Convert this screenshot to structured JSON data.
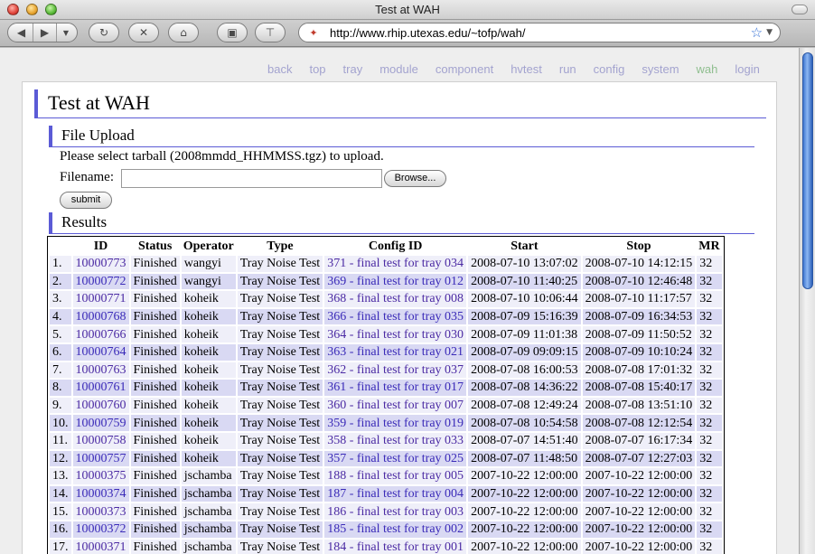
{
  "window": {
    "title": "Test at WAH"
  },
  "browser": {
    "url": "http://www.rhip.utexas.edu/~tofp/wah/"
  },
  "nav": {
    "items": [
      "back",
      "top",
      "tray",
      "module",
      "component",
      "hvtest",
      "run",
      "config",
      "system",
      "wah",
      "login"
    ],
    "current": "wah"
  },
  "page": {
    "title": "Test at WAH",
    "upload": {
      "heading": "File Upload",
      "instructions": "Please select tarball (2008mmdd_HHMMSS.tgz) to upload.",
      "filename_label": "Filename:",
      "browse_label": "Browse...",
      "submit_label": "submit"
    },
    "results": {
      "heading": "Results",
      "columns": [
        "",
        "ID",
        "Status",
        "Operator",
        "Type",
        "Config ID",
        "Start",
        "Stop",
        "MR"
      ],
      "rows": [
        [
          "1.",
          "10000773",
          "Finished",
          "wangyi",
          "Tray Noise Test",
          "371 - final test for tray 034",
          "2008-07-10 13:07:02",
          "2008-07-10 14:12:15",
          "32"
        ],
        [
          "2.",
          "10000772",
          "Finished",
          "wangyi",
          "Tray Noise Test",
          "369 - final test for tray 012",
          "2008-07-10 11:40:25",
          "2008-07-10 12:46:48",
          "32"
        ],
        [
          "3.",
          "10000771",
          "Finished",
          "koheik",
          "Tray Noise Test",
          "368 - final test for tray 008",
          "2008-07-10 10:06:44",
          "2008-07-10 11:17:57",
          "32"
        ],
        [
          "4.",
          "10000768",
          "Finished",
          "koheik",
          "Tray Noise Test",
          "366 - final test for tray 035",
          "2008-07-09 15:16:39",
          "2008-07-09 16:34:53",
          "32"
        ],
        [
          "5.",
          "10000766",
          "Finished",
          "koheik",
          "Tray Noise Test",
          "364 - final test for tray 030",
          "2008-07-09 11:01:38",
          "2008-07-09 11:50:52",
          "32"
        ],
        [
          "6.",
          "10000764",
          "Finished",
          "koheik",
          "Tray Noise Test",
          "363 - final test for tray 021",
          "2008-07-09 09:09:15",
          "2008-07-09 10:10:24",
          "32"
        ],
        [
          "7.",
          "10000763",
          "Finished",
          "koheik",
          "Tray Noise Test",
          "362 - final test for tray 037",
          "2008-07-08 16:00:53",
          "2008-07-08 17:01:32",
          "32"
        ],
        [
          "8.",
          "10000761",
          "Finished",
          "koheik",
          "Tray Noise Test",
          "361 - final test for tray 017",
          "2008-07-08 14:36:22",
          "2008-07-08 15:40:17",
          "32"
        ],
        [
          "9.",
          "10000760",
          "Finished",
          "koheik",
          "Tray Noise Test",
          "360 - final test for tray 007",
          "2008-07-08 12:49:24",
          "2008-07-08 13:51:10",
          "32"
        ],
        [
          "10.",
          "10000759",
          "Finished",
          "koheik",
          "Tray Noise Test",
          "359 - final test for tray 019",
          "2008-07-08 10:54:58",
          "2008-07-08 12:12:54",
          "32"
        ],
        [
          "11.",
          "10000758",
          "Finished",
          "koheik",
          "Tray Noise Test",
          "358 - final test for tray 033",
          "2008-07-07 14:51:40",
          "2008-07-07 16:17:34",
          "32"
        ],
        [
          "12.",
          "10000757",
          "Finished",
          "koheik",
          "Tray Noise Test",
          "357 - final test for tray 025",
          "2008-07-07 11:48:50",
          "2008-07-07 12:27:03",
          "32"
        ],
        [
          "13.",
          "10000375",
          "Finished",
          "jschamba",
          "Tray Noise Test",
          "188 - final test for tray 005",
          "2007-10-22 12:00:00",
          "2007-10-22 12:00:00",
          "32"
        ],
        [
          "14.",
          "10000374",
          "Finished",
          "jschamba",
          "Tray Noise Test",
          "187 - final test for tray 004",
          "2007-10-22 12:00:00",
          "2007-10-22 12:00:00",
          "32"
        ],
        [
          "15.",
          "10000373",
          "Finished",
          "jschamba",
          "Tray Noise Test",
          "186 - final test for tray 003",
          "2007-10-22 12:00:00",
          "2007-10-22 12:00:00",
          "32"
        ],
        [
          "16.",
          "10000372",
          "Finished",
          "jschamba",
          "Tray Noise Test",
          "185 - final test for tray 002",
          "2007-10-22 12:00:00",
          "2007-10-22 12:00:00",
          "32"
        ],
        [
          "17.",
          "10000371",
          "Finished",
          "jschamba",
          "Tray Noise Test",
          "184 - final test for tray 001",
          "2007-10-22 12:00:00",
          "2007-10-22 12:00:00",
          "32"
        ]
      ]
    }
  },
  "colors": {
    "heading_accent": "#5b5bd6",
    "row_odd": "#efeff9",
    "row_even": "#d9d9f3",
    "link": "#4b2aa3",
    "nav_link": "#a3a3cf",
    "nav_current": "#8fbe8f"
  },
  "icons": {
    "back": "back-arrow-icon",
    "forward": "forward-arrow-icon",
    "reload": "reload-icon",
    "stop": "stop-icon",
    "home": "home-icon",
    "bookmarks": "bookmark-icon",
    "add_bookmark": "add-bookmark-icon",
    "favicon": "site-favicon",
    "star": "star-icon"
  }
}
